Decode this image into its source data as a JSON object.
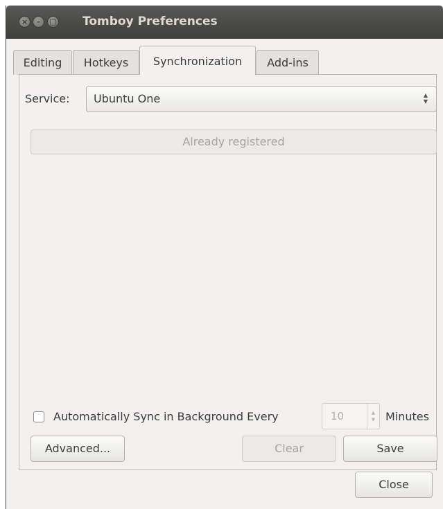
{
  "window": {
    "title": "Tomboy Preferences"
  },
  "tabs": [
    {
      "label": "Editing"
    },
    {
      "label": "Hotkeys"
    },
    {
      "label": "Synchronization"
    },
    {
      "label": "Add-ins"
    }
  ],
  "active_tab": "Synchronization",
  "sync": {
    "service_label": "Service:",
    "service_value": "Ubuntu One",
    "registered_label": "Already registered",
    "auto_sync_label": "Automatically Sync in Background Every",
    "auto_sync_checked": false,
    "interval_value": "10",
    "minutes_label": "Minutes",
    "advanced_label": "Advanced...",
    "clear_label": "Clear",
    "save_label": "Save"
  },
  "footer": {
    "close_label": "Close"
  },
  "icons": {
    "close": "close-icon",
    "minimize": "minimize-icon",
    "maximize": "maximize-icon",
    "combo_arrows": "updown-arrows-icon"
  }
}
